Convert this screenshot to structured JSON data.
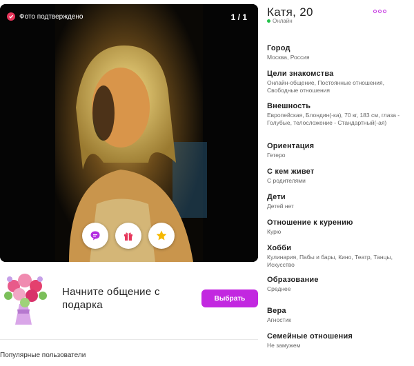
{
  "photo": {
    "verified_label": "Фото подтверждено",
    "counter": "1 / 1"
  },
  "actions": [
    {
      "icon": "chat-bubble-icon",
      "color": "#b22de0"
    },
    {
      "icon": "gift-icon",
      "color": "#e6365b"
    },
    {
      "icon": "star-icon",
      "color": "#f5b800"
    }
  ],
  "gift_banner": {
    "text": "Начните общение с подарка",
    "button": "Выбрать"
  },
  "popular_label": "Популярные пользователи",
  "profile": {
    "name": "Катя, 20",
    "status": "Онлайн",
    "fields": [
      {
        "label": "Город",
        "value": "Москва, Россия"
      },
      {
        "label": "Цели знакомства",
        "value": "Онлайн-общение, Постоянные отношения, Свободные отношения"
      },
      {
        "label": "Внешность",
        "value": "Европейская, Блондин(-ка), 70 кг, 183 см, глаза - Голубые, телосложение - Стандартный(-ая)"
      },
      {
        "label": "Ориентация",
        "value": "Гетеро"
      },
      {
        "label": "С кем живет",
        "value": "С родителями"
      },
      {
        "label": "Дети",
        "value": "Детей нет"
      },
      {
        "label": "Отношение к курению",
        "value": "Курю"
      },
      {
        "label": "Хобби",
        "value": "Кулинария, Пабы и бары, Кино, Театр, Танцы, Искусство"
      },
      {
        "label": "Образование",
        "value": "Среднее"
      },
      {
        "label": "Вера",
        "value": "Агностик"
      },
      {
        "label": "Семейные отношения",
        "value": "Не замужем"
      }
    ]
  },
  "colors": {
    "accent": "#c228e0",
    "online": "#23c24a",
    "verified": "#e6365b"
  }
}
